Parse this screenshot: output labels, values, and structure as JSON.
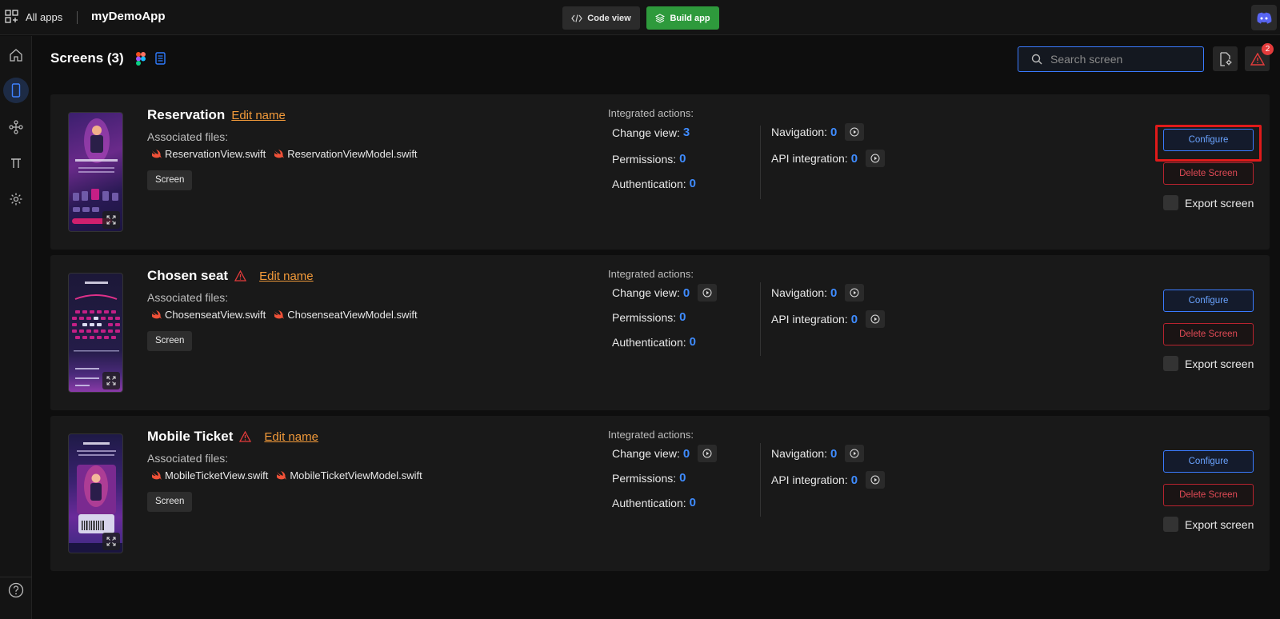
{
  "topbar": {
    "all_apps_label": "All apps",
    "app_name": "myDemoApp",
    "code_view_label": "Code view",
    "build_app_label": "Build app"
  },
  "header": {
    "title": "Screens (3)",
    "search_placeholder": "Search screen",
    "alert_count": "2"
  },
  "labels": {
    "edit_name": "Edit name",
    "associated_files": "Associated files:",
    "screen_chip": "Screen",
    "integrated_actions": "Integrated actions:",
    "change_view": "Change view:",
    "permissions": "Permissions:",
    "authentication": "Authentication:",
    "navigation": "Navigation:",
    "api_integration": "API integration:",
    "configure": "Configure",
    "delete_screen": "Delete Screen",
    "export_screen": "Export screen"
  },
  "screens": [
    {
      "name": "Reservation",
      "has_warning": false,
      "files": [
        "ReservationView.swift",
        "ReservationViewModel.swift"
      ],
      "change_view": "3",
      "permissions": "0",
      "authentication": "0",
      "navigation": "0",
      "api_integration": "0"
    },
    {
      "name": "Chosen seat",
      "has_warning": true,
      "files": [
        "ChosenseatView.swift",
        "ChosenseatViewModel.swift"
      ],
      "change_view": "0",
      "permissions": "0",
      "authentication": "0",
      "navigation": "0",
      "api_integration": "0"
    },
    {
      "name": "Mobile Ticket",
      "has_warning": true,
      "files": [
        "MobileTicketView.swift",
        "MobileTicketViewModel.swift"
      ],
      "change_view": "0",
      "permissions": "0",
      "authentication": "0",
      "navigation": "0",
      "api_integration": "0"
    }
  ],
  "colors": {
    "accent_blue": "#3f8cff",
    "build_green": "#2e9a3c",
    "edit_orange": "#f29a3a",
    "delete_red": "#e04a55",
    "highlight_red": "#e01a1a"
  }
}
